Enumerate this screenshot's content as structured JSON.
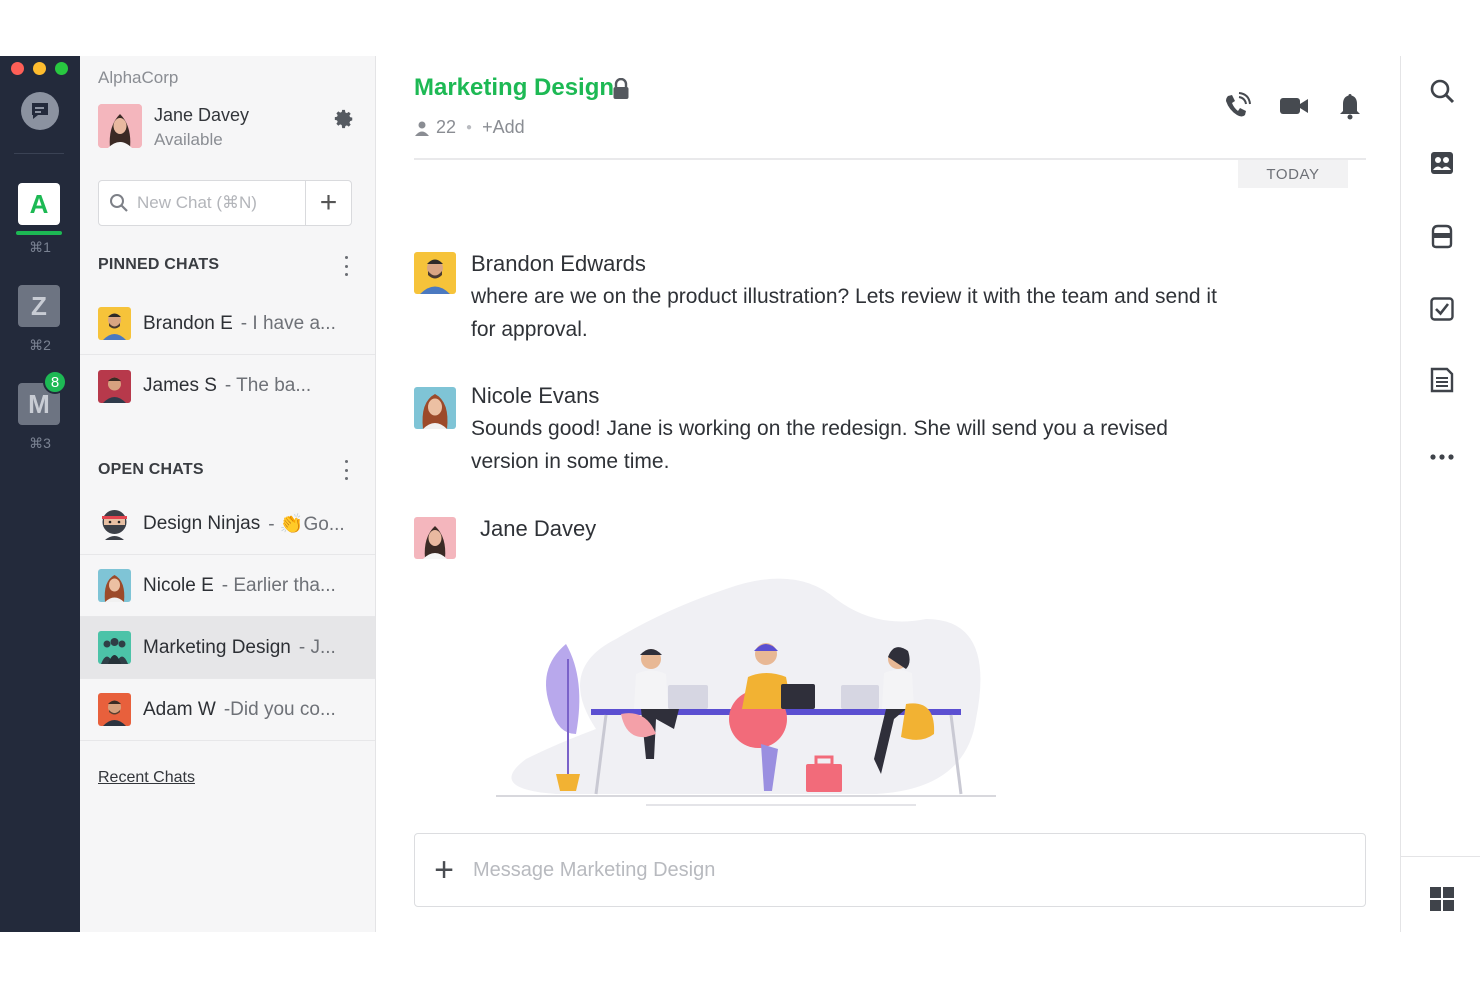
{
  "rail": {
    "workspaces": [
      {
        "letter": "A",
        "shortcut": "⌘1"
      },
      {
        "letter": "Z",
        "shortcut": "⌘2"
      },
      {
        "letter": "M",
        "shortcut": "⌘3",
        "badge": "8"
      }
    ]
  },
  "sidebar": {
    "org": "AlphaCorp",
    "user": {
      "name": "Jane Davey",
      "status": "Available"
    },
    "search": {
      "placeholder": "New Chat (⌘N)",
      "add": "+"
    },
    "pinned": {
      "heading": "PINNED CHATS",
      "items": [
        {
          "name": "Brandon E",
          "preview": "- I have a..."
        },
        {
          "name": "James S",
          "preview": "- The ba..."
        }
      ]
    },
    "open": {
      "heading": "OPEN CHATS",
      "items": [
        {
          "name": "Design Ninjas",
          "preview": "- 👏Go..."
        },
        {
          "name": "Nicole E",
          "preview": "- Earlier tha..."
        },
        {
          "name": "Marketing Design",
          "preview": "- J..."
        },
        {
          "name": "Adam W",
          "preview": "-Did you co..."
        }
      ]
    },
    "recent_link": "Recent Chats"
  },
  "channel": {
    "title": "Marketing Design",
    "members": "22",
    "add": "+Add",
    "date_divider": "TODAY"
  },
  "messages": [
    {
      "author": "Brandon Edwards",
      "text": "where are we on the product illustration? Lets review it with the team and send it for approval."
    },
    {
      "author": "Nicole Evans",
      "text": "Sounds good! Jane is working on the redesign. She will send you a revised version in some time."
    },
    {
      "author": "Jane Davey",
      "text": ""
    }
  ],
  "composer": {
    "placeholder": "Message Marketing Design",
    "add": "+"
  },
  "colors": {
    "accent": "#1db954",
    "rail": "#232a3b",
    "sidebar": "#f6f6f7"
  },
  "icons": {
    "header": [
      "phone-icon",
      "video-icon",
      "bell-icon"
    ],
    "right_rail": [
      "search-icon",
      "contacts-icon",
      "inbox-icon",
      "tasks-icon",
      "notes-icon",
      "more-icon",
      "apps-grid-icon"
    ]
  }
}
